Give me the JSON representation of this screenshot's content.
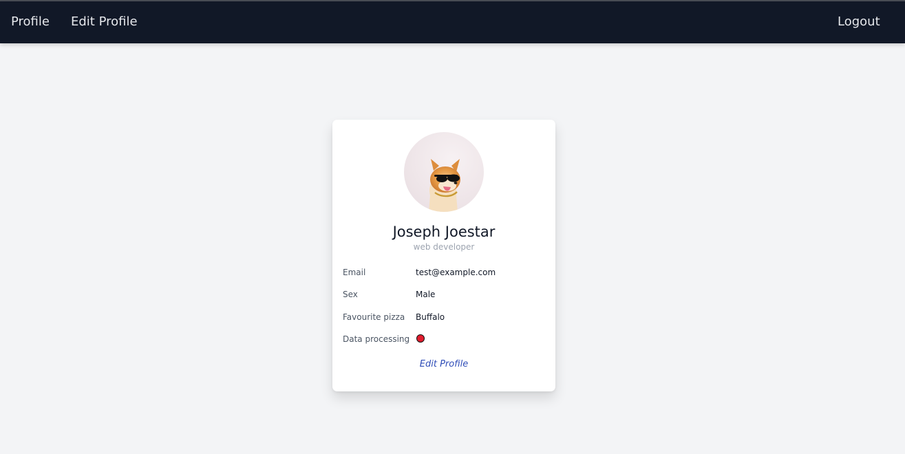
{
  "nav": {
    "profile_label": "Profile",
    "edit_profile_label": "Edit Profile",
    "logout_label": "Logout"
  },
  "profile": {
    "avatar_icon": "dog-with-sunglasses-photo",
    "name": "Joseph Joestar",
    "title": "web developer",
    "fields": [
      {
        "label": "Email",
        "value": "test@example.com"
      },
      {
        "label": "Sex",
        "value": "Male"
      },
      {
        "label": "Favourite pizza",
        "value": "Buffalo"
      },
      {
        "label": "Data processing",
        "status_color": "#e11d2e"
      }
    ],
    "edit_link": "Edit Profile"
  },
  "colors": {
    "navbar_bg": "#111827",
    "page_bg": "#f3f4f6",
    "link": "#2f4db8"
  }
}
